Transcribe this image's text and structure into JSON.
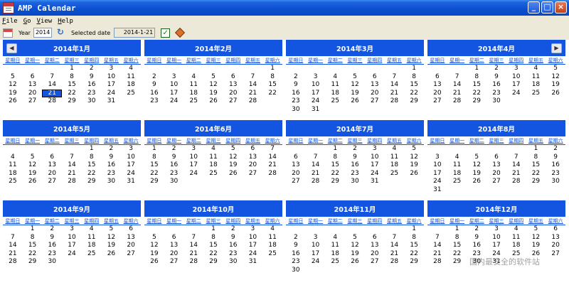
{
  "window": {
    "title": "AMP Calendar"
  },
  "menu": [
    {
      "name": "menu-file",
      "label": "File"
    },
    {
      "name": "menu-go",
      "label": "Go"
    },
    {
      "name": "menu-view",
      "label": "View"
    },
    {
      "name": "menu-help",
      "label": "Help"
    }
  ],
  "toolbar": {
    "year_label": "Year",
    "year_value": "2014",
    "selected_label": "Selected date",
    "selected_value": "2014-1-21"
  },
  "weekdays": [
    "星期日",
    "星期一",
    "星期二",
    "星期三",
    "星期四",
    "星期五",
    "星期六"
  ],
  "months": [
    {
      "title": "2014年1月",
      "offset": 3,
      "days": 31
    },
    {
      "title": "2014年2月",
      "offset": 6,
      "days": 28
    },
    {
      "title": "2014年3月",
      "offset": 6,
      "days": 31
    },
    {
      "title": "2014年4月",
      "offset": 2,
      "days": 30
    },
    {
      "title": "2014年5月",
      "offset": 4,
      "days": 31
    },
    {
      "title": "2014年6月",
      "offset": 0,
      "days": 30
    },
    {
      "title": "2014年7月",
      "offset": 2,
      "days": 31
    },
    {
      "title": "2014年8月",
      "offset": 5,
      "days": 31
    },
    {
      "title": "2014年9月",
      "offset": 1,
      "days": 30
    },
    {
      "title": "2014年10月",
      "offset": 3,
      "days": 31
    },
    {
      "title": "2014年11月",
      "offset": 6,
      "days": 30
    },
    {
      "title": "2014年12月",
      "offset": 1,
      "days": 31
    }
  ],
  "selected": {
    "month": 1,
    "day": 21
  },
  "watermark": "国内最安全的软件站",
  "colors": {
    "header": "#1354E0",
    "titlebar": "#0A4FD0",
    "background": "#ECE9D8"
  }
}
